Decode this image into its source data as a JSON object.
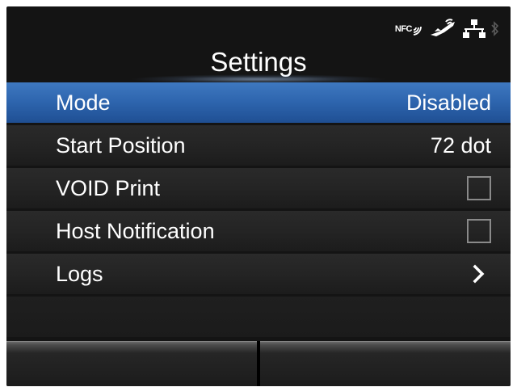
{
  "status_bar": {
    "nfc_label": "NFC",
    "icons": [
      "nfc-icon",
      "wireless-lan-icon",
      "wired-lan-icon",
      "bluetooth-icon"
    ]
  },
  "header": {
    "title": "Settings"
  },
  "menu": {
    "items": [
      {
        "label": "Mode",
        "value": "Disabled",
        "control": "value",
        "selected": true
      },
      {
        "label": "Start Position",
        "value": "72 dot",
        "control": "value",
        "selected": false
      },
      {
        "label": "VOID Print",
        "control": "checkbox",
        "checked": false,
        "selected": false
      },
      {
        "label": "Host Notification",
        "control": "checkbox",
        "checked": false,
        "selected": false
      },
      {
        "label": "Logs",
        "control": "chevron-right-icon",
        "selected": false
      }
    ]
  },
  "colors": {
    "background": "#141414",
    "selected_row": "#2d64ad",
    "text": "#ffffff"
  }
}
